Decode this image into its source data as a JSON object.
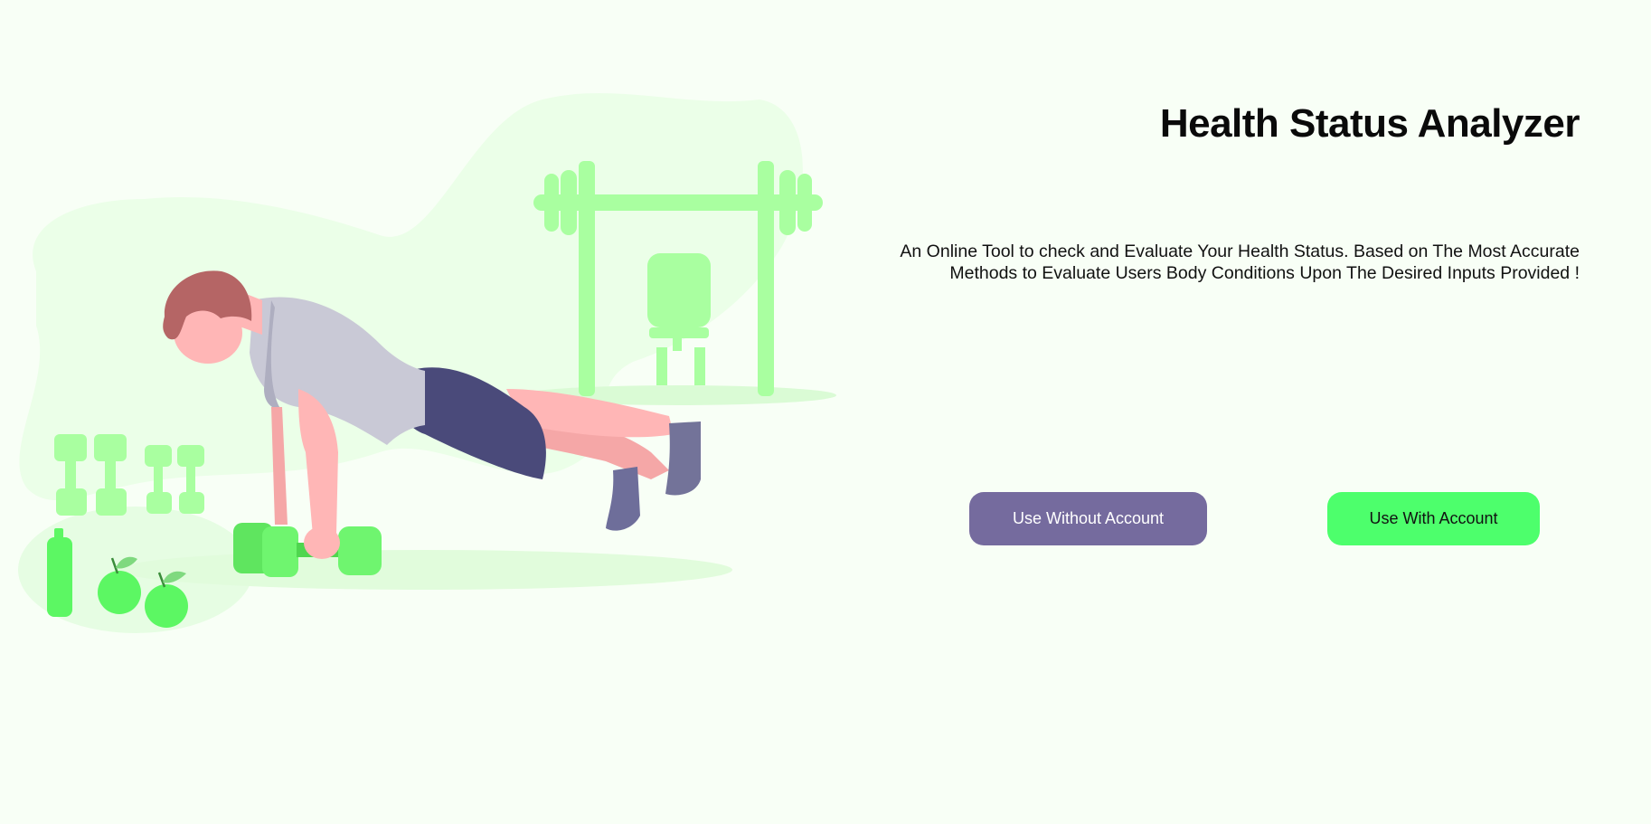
{
  "hero": {
    "title": "Health Status Analyzer",
    "description": "An Online Tool to check and Evaluate Your Health Status. Based on The Most Accurate Methods to Evaluate Users Body Conditions Upon The Desired Inputs Provided !"
  },
  "actions": {
    "guest_label": "Use Without Account",
    "account_label": "Use With Account"
  },
  "illustration": {
    "subject": "workout-pushup-illustration"
  },
  "colors": {
    "background": "#f8fff6",
    "blob": "#ebffe8",
    "equipment": "#a9ffa0",
    "accent_green": "#4dff6c",
    "accent_purple": "#756b9e",
    "shorts": "#4a4a7a",
    "shirt": "#c9c9d6",
    "skin": "#ffb6b6",
    "hair": "#b56565"
  }
}
